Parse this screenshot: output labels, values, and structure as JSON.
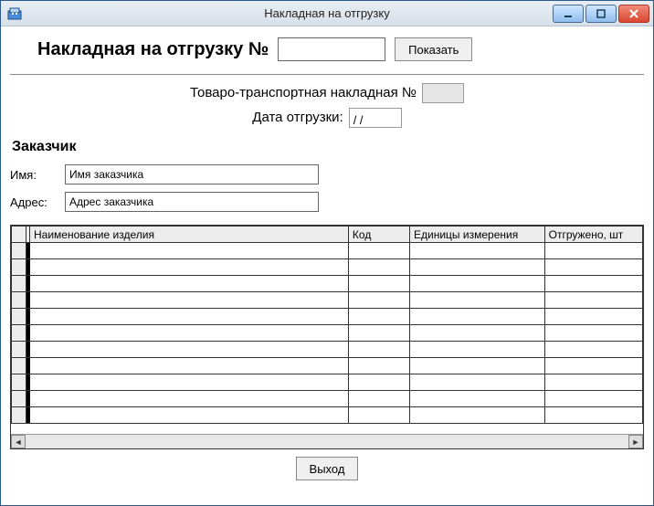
{
  "window": {
    "title": "Накладная на отгрузку"
  },
  "header": {
    "title": "Накладная на отгрузку №",
    "number_value": "",
    "show_label": "Показать"
  },
  "info": {
    "ttn_label": "Товаро-транспортная накладная №",
    "ttn_value": "",
    "date_label": "Дата отгрузки:",
    "date_value": "  /  /"
  },
  "customer": {
    "section": "Заказчик",
    "name_label": "Имя:",
    "name_value": "Имя заказчика",
    "addr_label": "Адрес:",
    "addr_value": "Адрес заказчика"
  },
  "grid": {
    "columns": [
      "Наименование изделия",
      "Код",
      "Единицы измерения",
      "Отгружено, шт"
    ],
    "rows": [
      {
        "name": "",
        "code": "",
        "unit": "",
        "qty": ""
      },
      {
        "name": "",
        "code": "",
        "unit": "",
        "qty": ""
      },
      {
        "name": "",
        "code": "",
        "unit": "",
        "qty": ""
      },
      {
        "name": "",
        "code": "",
        "unit": "",
        "qty": ""
      },
      {
        "name": "",
        "code": "",
        "unit": "",
        "qty": ""
      },
      {
        "name": "",
        "code": "",
        "unit": "",
        "qty": ""
      },
      {
        "name": "",
        "code": "",
        "unit": "",
        "qty": ""
      },
      {
        "name": "",
        "code": "",
        "unit": "",
        "qty": ""
      },
      {
        "name": "",
        "code": "",
        "unit": "",
        "qty": ""
      },
      {
        "name": "",
        "code": "",
        "unit": "",
        "qty": ""
      },
      {
        "name": "",
        "code": "",
        "unit": "",
        "qty": ""
      }
    ]
  },
  "footer": {
    "exit_label": "Выход"
  }
}
